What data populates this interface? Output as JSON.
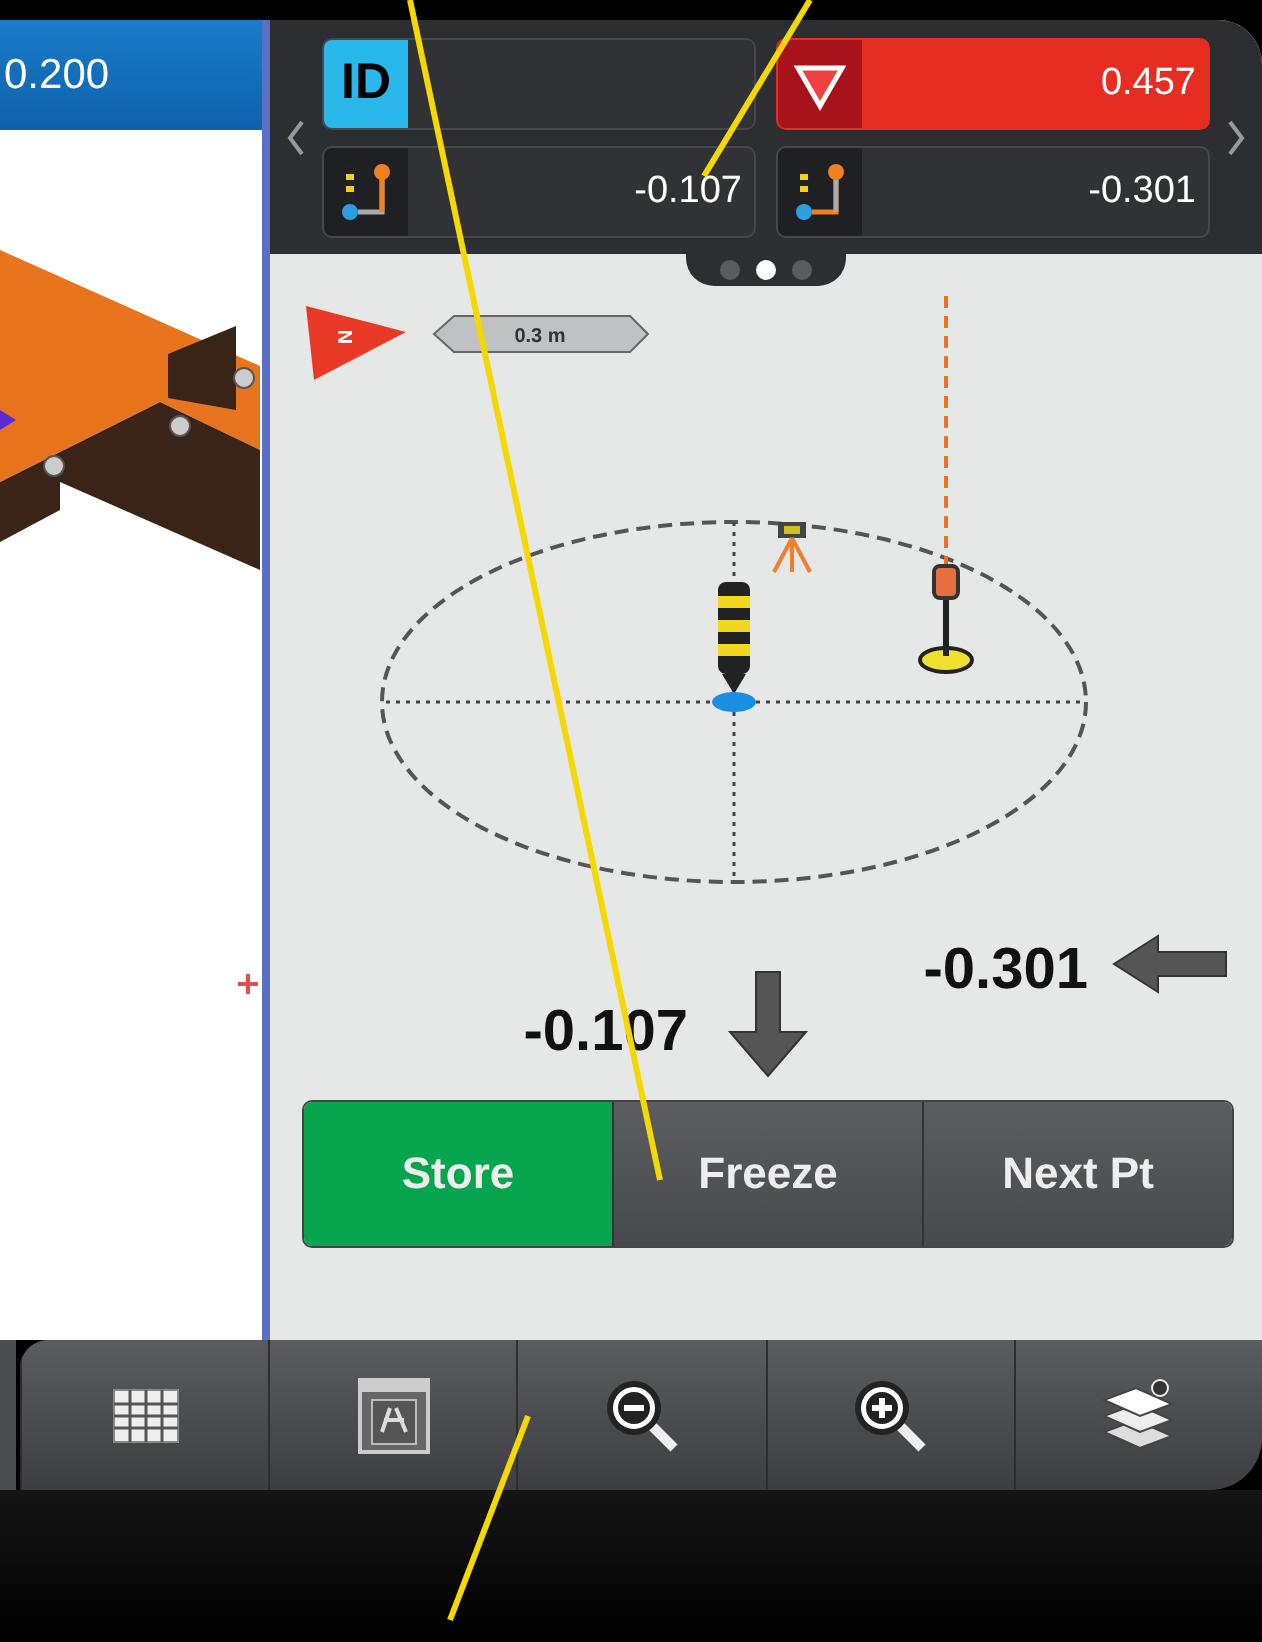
{
  "left_panel": {
    "header_value": "0.200"
  },
  "readouts": [
    {
      "kind": "id",
      "label": "ID",
      "alert": false
    },
    {
      "kind": "cut-fill",
      "value": "0.457",
      "alert": true
    },
    {
      "kind": "offset-a",
      "value": "-0.107",
      "alert": false
    },
    {
      "kind": "offset-b",
      "value": "-0.301",
      "alert": false
    }
  ],
  "pager": [
    {
      "selected": false
    },
    {
      "selected": true
    },
    {
      "selected": false
    }
  ],
  "plan_view": {
    "north": "N",
    "scale": "0.3 m"
  },
  "deltas": [
    {
      "kind": "down",
      "value": "-0.107"
    },
    {
      "kind": "left",
      "value": "-0.301"
    }
  ],
  "actions": [
    {
      "label": "Store",
      "primary": true
    },
    {
      "label": "Freeze",
      "primary": false
    },
    {
      "label": "Next Pt",
      "primary": false
    }
  ],
  "toolbar": [
    {
      "kind": "table"
    },
    {
      "kind": "calculator"
    },
    {
      "kind": "zoom-out"
    },
    {
      "kind": "zoom-in"
    },
    {
      "kind": "layers"
    }
  ]
}
